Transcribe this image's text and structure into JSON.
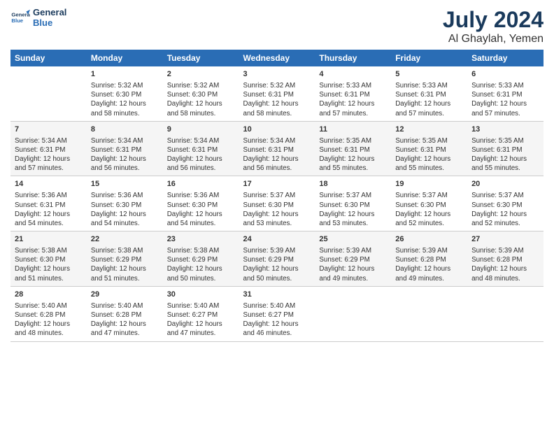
{
  "header": {
    "logo_line1": "General",
    "logo_line2": "Blue",
    "title": "July 2024",
    "subtitle": "Al Ghaylah, Yemen"
  },
  "days_of_week": [
    "Sunday",
    "Monday",
    "Tuesday",
    "Wednesday",
    "Thursday",
    "Friday",
    "Saturday"
  ],
  "weeks": [
    [
      {
        "day": "",
        "sunrise": "",
        "sunset": "",
        "daylight": ""
      },
      {
        "day": "1",
        "sunrise": "Sunrise: 5:32 AM",
        "sunset": "Sunset: 6:30 PM",
        "daylight": "Daylight: 12 hours and 58 minutes."
      },
      {
        "day": "2",
        "sunrise": "Sunrise: 5:32 AM",
        "sunset": "Sunset: 6:30 PM",
        "daylight": "Daylight: 12 hours and 58 minutes."
      },
      {
        "day": "3",
        "sunrise": "Sunrise: 5:32 AM",
        "sunset": "Sunset: 6:31 PM",
        "daylight": "Daylight: 12 hours and 58 minutes."
      },
      {
        "day": "4",
        "sunrise": "Sunrise: 5:33 AM",
        "sunset": "Sunset: 6:31 PM",
        "daylight": "Daylight: 12 hours and 57 minutes."
      },
      {
        "day": "5",
        "sunrise": "Sunrise: 5:33 AM",
        "sunset": "Sunset: 6:31 PM",
        "daylight": "Daylight: 12 hours and 57 minutes."
      },
      {
        "day": "6",
        "sunrise": "Sunrise: 5:33 AM",
        "sunset": "Sunset: 6:31 PM",
        "daylight": "Daylight: 12 hours and 57 minutes."
      }
    ],
    [
      {
        "day": "7",
        "sunrise": "Sunrise: 5:34 AM",
        "sunset": "Sunset: 6:31 PM",
        "daylight": "Daylight: 12 hours and 57 minutes."
      },
      {
        "day": "8",
        "sunrise": "Sunrise: 5:34 AM",
        "sunset": "Sunset: 6:31 PM",
        "daylight": "Daylight: 12 hours and 56 minutes."
      },
      {
        "day": "9",
        "sunrise": "Sunrise: 5:34 AM",
        "sunset": "Sunset: 6:31 PM",
        "daylight": "Daylight: 12 hours and 56 minutes."
      },
      {
        "day": "10",
        "sunrise": "Sunrise: 5:34 AM",
        "sunset": "Sunset: 6:31 PM",
        "daylight": "Daylight: 12 hours and 56 minutes."
      },
      {
        "day": "11",
        "sunrise": "Sunrise: 5:35 AM",
        "sunset": "Sunset: 6:31 PM",
        "daylight": "Daylight: 12 hours and 55 minutes."
      },
      {
        "day": "12",
        "sunrise": "Sunrise: 5:35 AM",
        "sunset": "Sunset: 6:31 PM",
        "daylight": "Daylight: 12 hours and 55 minutes."
      },
      {
        "day": "13",
        "sunrise": "Sunrise: 5:35 AM",
        "sunset": "Sunset: 6:31 PM",
        "daylight": "Daylight: 12 hours and 55 minutes."
      }
    ],
    [
      {
        "day": "14",
        "sunrise": "Sunrise: 5:36 AM",
        "sunset": "Sunset: 6:31 PM",
        "daylight": "Daylight: 12 hours and 54 minutes."
      },
      {
        "day": "15",
        "sunrise": "Sunrise: 5:36 AM",
        "sunset": "Sunset: 6:30 PM",
        "daylight": "Daylight: 12 hours and 54 minutes."
      },
      {
        "day": "16",
        "sunrise": "Sunrise: 5:36 AM",
        "sunset": "Sunset: 6:30 PM",
        "daylight": "Daylight: 12 hours and 54 minutes."
      },
      {
        "day": "17",
        "sunrise": "Sunrise: 5:37 AM",
        "sunset": "Sunset: 6:30 PM",
        "daylight": "Daylight: 12 hours and 53 minutes."
      },
      {
        "day": "18",
        "sunrise": "Sunrise: 5:37 AM",
        "sunset": "Sunset: 6:30 PM",
        "daylight": "Daylight: 12 hours and 53 minutes."
      },
      {
        "day": "19",
        "sunrise": "Sunrise: 5:37 AM",
        "sunset": "Sunset: 6:30 PM",
        "daylight": "Daylight: 12 hours and 52 minutes."
      },
      {
        "day": "20",
        "sunrise": "Sunrise: 5:37 AM",
        "sunset": "Sunset: 6:30 PM",
        "daylight": "Daylight: 12 hours and 52 minutes."
      }
    ],
    [
      {
        "day": "21",
        "sunrise": "Sunrise: 5:38 AM",
        "sunset": "Sunset: 6:30 PM",
        "daylight": "Daylight: 12 hours and 51 minutes."
      },
      {
        "day": "22",
        "sunrise": "Sunrise: 5:38 AM",
        "sunset": "Sunset: 6:29 PM",
        "daylight": "Daylight: 12 hours and 51 minutes."
      },
      {
        "day": "23",
        "sunrise": "Sunrise: 5:38 AM",
        "sunset": "Sunset: 6:29 PM",
        "daylight": "Daylight: 12 hours and 50 minutes."
      },
      {
        "day": "24",
        "sunrise": "Sunrise: 5:39 AM",
        "sunset": "Sunset: 6:29 PM",
        "daylight": "Daylight: 12 hours and 50 minutes."
      },
      {
        "day": "25",
        "sunrise": "Sunrise: 5:39 AM",
        "sunset": "Sunset: 6:29 PM",
        "daylight": "Daylight: 12 hours and 49 minutes."
      },
      {
        "day": "26",
        "sunrise": "Sunrise: 5:39 AM",
        "sunset": "Sunset: 6:28 PM",
        "daylight": "Daylight: 12 hours and 49 minutes."
      },
      {
        "day": "27",
        "sunrise": "Sunrise: 5:39 AM",
        "sunset": "Sunset: 6:28 PM",
        "daylight": "Daylight: 12 hours and 48 minutes."
      }
    ],
    [
      {
        "day": "28",
        "sunrise": "Sunrise: 5:40 AM",
        "sunset": "Sunset: 6:28 PM",
        "daylight": "Daylight: 12 hours and 48 minutes."
      },
      {
        "day": "29",
        "sunrise": "Sunrise: 5:40 AM",
        "sunset": "Sunset: 6:28 PM",
        "daylight": "Daylight: 12 hours and 47 minutes."
      },
      {
        "day": "30",
        "sunrise": "Sunrise: 5:40 AM",
        "sunset": "Sunset: 6:27 PM",
        "daylight": "Daylight: 12 hours and 47 minutes."
      },
      {
        "day": "31",
        "sunrise": "Sunrise: 5:40 AM",
        "sunset": "Sunset: 6:27 PM",
        "daylight": "Daylight: 12 hours and 46 minutes."
      },
      {
        "day": "",
        "sunrise": "",
        "sunset": "",
        "daylight": ""
      },
      {
        "day": "",
        "sunrise": "",
        "sunset": "",
        "daylight": ""
      },
      {
        "day": "",
        "sunrise": "",
        "sunset": "",
        "daylight": ""
      }
    ]
  ]
}
